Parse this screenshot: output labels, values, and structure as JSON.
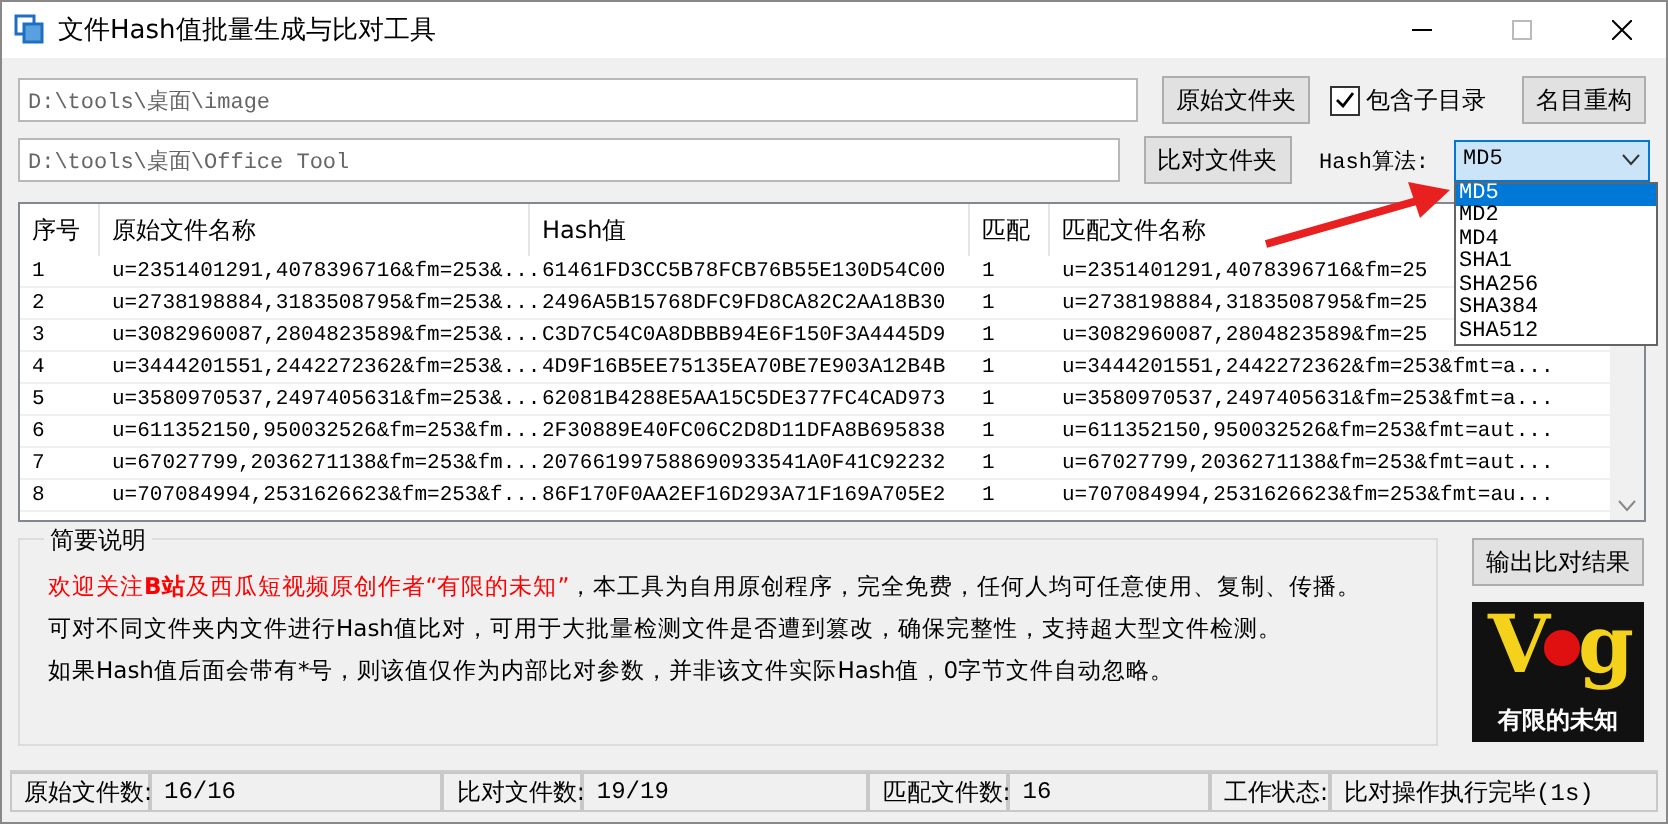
{
  "window": {
    "title": "文件Hash值批量生成与比对工具"
  },
  "original_folder": {
    "value": "D:\\tools\\桌面\\image",
    "button": "原始文件夹"
  },
  "compare_folder": {
    "value": "D:\\tools\\桌面\\Office Tool",
    "button": "比对文件夹"
  },
  "include_subdirs": {
    "label": "包含子目录",
    "checked": true
  },
  "rename_button": "名目重构",
  "hash_algorithm": {
    "label": "Hash算法:",
    "value": "MD5",
    "expanded": true,
    "options": [
      {
        "label": "MD5",
        "selected": true
      },
      {
        "label": "MD2",
        "selected": false
      },
      {
        "label": "MD4",
        "selected": false
      },
      {
        "label": "SHA1",
        "selected": false
      },
      {
        "label": "SHA256",
        "selected": false
      },
      {
        "label": "SHA384",
        "selected": false
      },
      {
        "label": "SHA512",
        "selected": false
      }
    ]
  },
  "table": {
    "columns": [
      "序号",
      "原始文件名称",
      "Hash值",
      "匹配",
      "匹配文件名称"
    ],
    "rows": [
      [
        "1",
        "u=2351401291,4078396716&fm=253&...",
        "61461FD3CC5B78FCB76B55E130D54C00",
        "1",
        "u=2351401291,4078396716&fm=25"
      ],
      [
        "2",
        "u=2738198884,3183508795&fm=253&...",
        "2496A5B15768DFC9FD8CA82C2AA18B30",
        "1",
        "u=2738198884,3183508795&fm=25"
      ],
      [
        "3",
        "u=3082960087,2804823589&fm=253&...",
        "C3D7C54C0A8DBBB94E6F150F3A4445D9",
        "1",
        "u=3082960087,2804823589&fm=25"
      ],
      [
        "4",
        "u=3444201551,2442272362&fm=253&...",
        "4D9F16B5EE75135EA70BE7E903A12B4B",
        "1",
        "u=3444201551,2442272362&fm=253&fmt=a..."
      ],
      [
        "5",
        "u=3580970537,2497405631&fm=253&...",
        "62081B4288E5AA15C5DE377FC4CAD973",
        "1",
        "u=3580970537,2497405631&fm=253&fmt=a..."
      ],
      [
        "6",
        "u=611352150,950032526&fm=253&fm...",
        "2F30889E40FC06C2D8D11DFA8B695838",
        "1",
        "u=611352150,950032526&fm=253&fmt=aut..."
      ],
      [
        "7",
        "u=67027799,2036271138&fm=253&fm...",
        "207661997588690933541A0F41C92232",
        "1",
        "u=67027799,2036271138&fm=253&fmt=aut..."
      ],
      [
        "8",
        "u=707084994,2531626623&fm=253&f...",
        "86F170F0AA2EF16D293A71F169A705E2",
        "1",
        "u=707084994,2531626623&fm=253&fmt=au..."
      ]
    ]
  },
  "description": {
    "title": "简要说明",
    "highlight": "欢迎关注**B站**及西瓜短视频原创作者“有限的未知”",
    "lines": [
      "，本工具为自用原创程序，完全免费，任何人均可任意使用、复制、传播。",
      "可对不同文件夹内文件进行Hash值比对，可用于大批量检测文件是否遭到篡改，确保完整性，支持超大型文件检测。",
      "如果Hash值后面会带有*号，则该值仅作为内部比对参数，并非该文件实际Hash值，0字节文件自动忽略。"
    ]
  },
  "export_button": "输出比对结果",
  "logo": {
    "letters": "Vg",
    "caption": "有限的未知"
  },
  "status_bar": [
    {
      "label": "原始文件数:",
      "value": "16/16"
    },
    {
      "label": "比对文件数:",
      "value": "19/19"
    },
    {
      "label": "匹配文件数:",
      "value": "16"
    },
    {
      "label": "工作状态:",
      "value": "比对操作执行完毕(1s)"
    }
  ]
}
